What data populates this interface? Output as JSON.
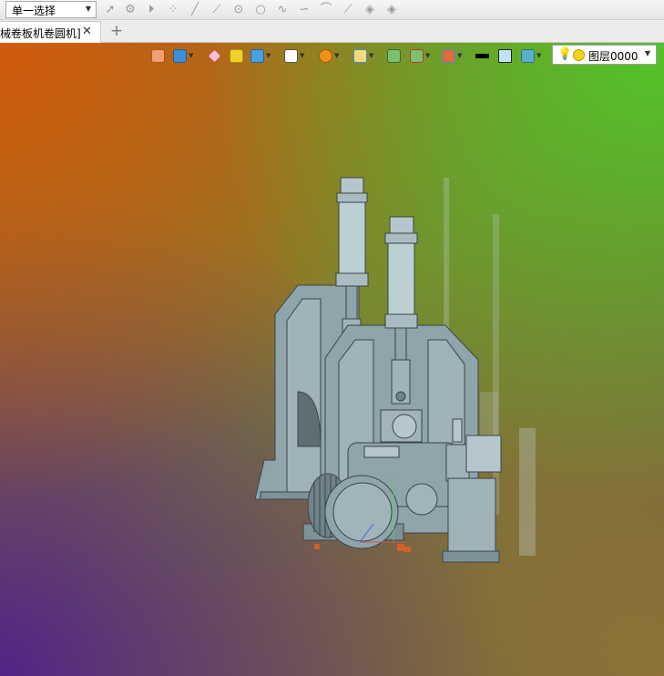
{
  "toolbar": {
    "select_mode_value": "单一选择",
    "tools": [
      "pointer-icon",
      "select-filter-icon",
      "play-icon",
      "point-icon",
      "line-icon",
      "line-icon",
      "circle-point-icon",
      "circle-icon",
      "spline-icon",
      "arc-icon",
      "edit-line-icon",
      "layer-stack-icon",
      "layer-stack-icon"
    ]
  },
  "tabs": {
    "document_title": "械卷板机卷圆机]",
    "close_symbol": "✕",
    "add_symbol": "+"
  },
  "view_toolbar": {
    "items": [
      "exit-view-icon",
      "render-mode-icon",
      "pencil-icon",
      "box-solid-icon",
      "cube-icon",
      "view-cube-icon",
      "color-wheel-icon",
      "zoom-icon",
      "image-icon",
      "section-icon",
      "assembly-icon",
      "line-color-swatch",
      "fill-color-swatch",
      "layer-display-icon"
    ]
  },
  "layer_selector": {
    "value": "图层0000"
  },
  "colors": {
    "model_body": "#8fa4ab",
    "model_edge": "#3a4549",
    "viewport_top_left": "#d25a0a",
    "viewport_top_right": "#50c828",
    "viewport_bottom_left": "#501e8c"
  }
}
